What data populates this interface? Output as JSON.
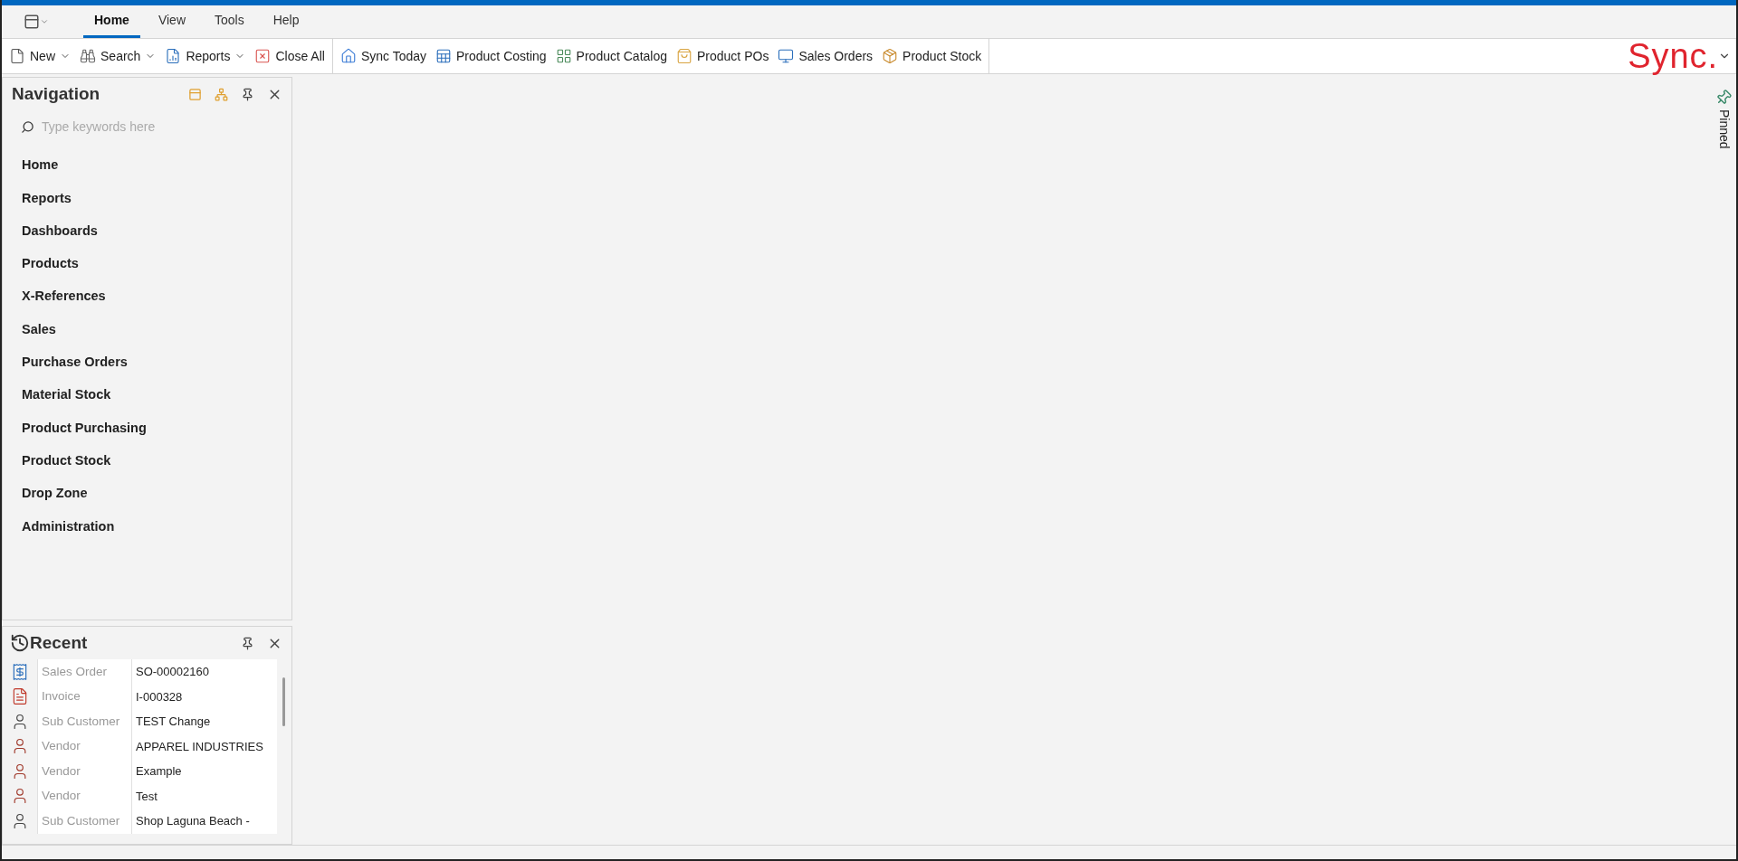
{
  "menu_tabs": [
    {
      "label": "Home",
      "selected": true
    },
    {
      "label": "View",
      "selected": false
    },
    {
      "label": "Tools",
      "selected": false
    },
    {
      "label": "Help",
      "selected": false
    }
  ],
  "toolbar": {
    "groups": [
      [
        {
          "label": "New",
          "dropdown": true
        },
        {
          "label": "Search",
          "dropdown": true
        },
        {
          "label": "Reports",
          "dropdown": true
        },
        {
          "label": "Close All",
          "dropdown": false
        }
      ],
      [
        {
          "label": "Sync Today",
          "dropdown": false
        },
        {
          "label": "Product Costing",
          "dropdown": false
        },
        {
          "label": "Product Catalog",
          "dropdown": false
        },
        {
          "label": "Product POs",
          "dropdown": false
        },
        {
          "label": "Sales Orders",
          "dropdown": false
        },
        {
          "label": "Product Stock",
          "dropdown": false
        }
      ]
    ],
    "logo": "Sync."
  },
  "navigation": {
    "title": "Navigation",
    "search": {
      "placeholder": "Type keywords here"
    },
    "items": [
      "Home",
      "Reports",
      "Dashboards",
      "Products",
      "X-References",
      "Sales",
      "Purchase Orders",
      "Material Stock",
      "Product Purchasing",
      "Product Stock",
      "Drop Zone",
      "Administration"
    ]
  },
  "recent": {
    "title": "Recent",
    "rows": [
      {
        "kind": "sales-order",
        "type": "Sales Order",
        "value": "SO-00002160"
      },
      {
        "kind": "invoice",
        "type": "Invoice",
        "value": "I-000328"
      },
      {
        "kind": "person",
        "type": "Sub Customer",
        "value": "TEST Change"
      },
      {
        "kind": "vendor",
        "type": "Vendor",
        "value": "APPAREL INDUSTRIES"
      },
      {
        "kind": "vendor",
        "type": "Vendor",
        "value": "Example"
      },
      {
        "kind": "vendor",
        "type": "Vendor",
        "value": "Test"
      },
      {
        "kind": "person",
        "type": "Sub Customer",
        "value": "Shop Laguna Beach -"
      }
    ]
  },
  "side_tab": {
    "label": "Pinned"
  }
}
